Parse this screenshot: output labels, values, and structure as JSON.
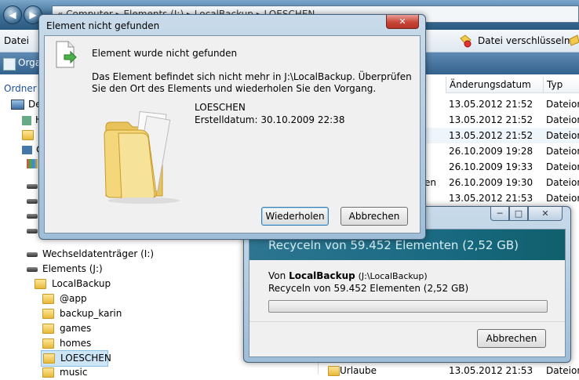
{
  "explorer": {
    "address": "« Computer ▸ Elements (J:) ▸ LocalBackup ▸ LOESCHEN",
    "menu_datei": "Datei",
    "toolbar_org": "Orga",
    "encrypt_button": "Datei verschlüsseln",
    "nav_label": "Ordner",
    "tree_computer_label": "De",
    "tree_short": [
      "H",
      "C",
      "C"
    ],
    "tree": [
      {
        "label": "Wechseldatenträger (I:)",
        "icon": "drive-icon"
      },
      {
        "label": "Elements (J:)",
        "icon": "drive-icon"
      },
      {
        "label": "LocalBackup",
        "icon": "folder-icon"
      },
      {
        "label": "@app",
        "icon": "folder-icon"
      },
      {
        "label": "backup_karin",
        "icon": "folder-icon"
      },
      {
        "label": "games",
        "icon": "folder-icon"
      },
      {
        "label": "homes",
        "icon": "folder-icon"
      },
      {
        "label": "LOESCHEN",
        "icon": "folder-icon",
        "selected": true
      },
      {
        "label": "music",
        "icon": "folder-icon"
      }
    ],
    "columns": {
      "date": "Änderungsdatum",
      "type": "Typ"
    },
    "rows": [
      {
        "date": "13.05.2012 21:52",
        "type": "Dateiord"
      },
      {
        "date": "13.05.2012 21:52",
        "type": "Dateiord"
      },
      {
        "date": "13.05.2012 21:52",
        "type": "Dateiord"
      },
      {
        "date": "26.10.2009 19:28",
        "type": "Dateiord"
      },
      {
        "date": "26.10.2009 19:33",
        "type": "Dateiord"
      },
      {
        "date": "26.10.2009 19:30",
        "type": "Dateiord"
      },
      {
        "date": "13.05.2012 21:53",
        "type": "Dateiord"
      }
    ],
    "partial_name": "en",
    "bottom_row": {
      "name": "Urlaube",
      "date": "13.05.2012 21:53",
      "type": "Dateiord"
    }
  },
  "dialog": {
    "title": "Element nicht gefunden",
    "close_glyph": "✕",
    "heading": "Element wurde nicht gefunden",
    "message": "Das Element befindet sich nicht mehr in J:\\LocalBackup. Überprüfen Sie den Ort des Elements und wiederholen Sie den Vorgang.",
    "item_name": "LOESCHEN",
    "item_created": "Erstelldatum: 30.10.2009 22:38",
    "retry_label": "Wiederholen",
    "cancel_label": "Abbrechen"
  },
  "progress": {
    "header": "Recyceln von 59.452 Elementen (2,52 GB)",
    "from_prefix": "Von",
    "from_bold": "LocalBackup",
    "from_path": "(J:\\LocalBackup)",
    "detail": "Recyceln von 59.452 Elementen (2,52 GB)",
    "progress_fraction": 0,
    "cancel_label": "Abbrechen",
    "min_glyph": "─",
    "max_glyph": "□",
    "close_glyph": "✕"
  },
  "colors": {
    "header_teal": "#1f6e8c",
    "dialog_bg": "#f0f0f0",
    "close_red": "#c9453a"
  }
}
